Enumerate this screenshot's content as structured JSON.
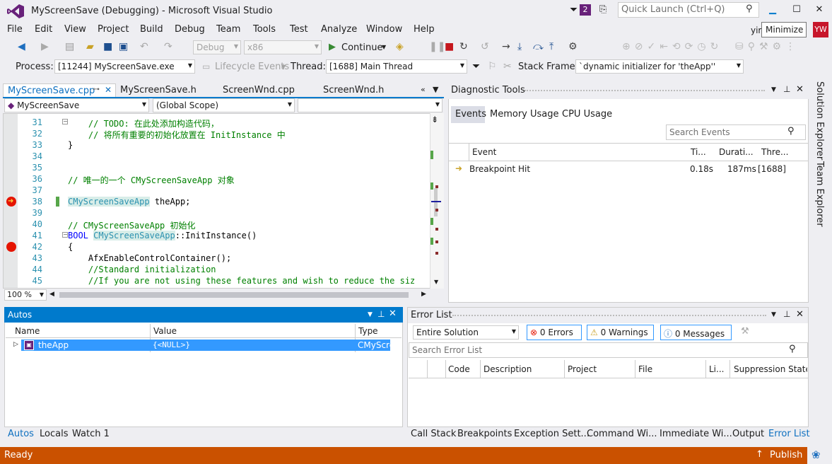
{
  "title": {
    "app_title": "MyScreenSave (Debugging) - Microsoft Visual Studio",
    "notif_count": "2",
    "quick_launch_placeholder": "Quick Launch (Ctrl+Q)",
    "user_name": "yir",
    "user_initials": "YW",
    "tooltip": "Minimize"
  },
  "menu": [
    "File",
    "Edit",
    "View",
    "Project",
    "Build",
    "Debug",
    "Team",
    "Tools",
    "Test",
    "Analyze",
    "Window",
    "Help"
  ],
  "toolbar": {
    "config": "Debug",
    "platform": "x86",
    "continue_label": "Continue"
  },
  "toolbar2": {
    "process_label": "Process:",
    "process_value": "[11244] MyScreenSave.exe",
    "lifecycle_label": "Lifecycle Events",
    "thread_label": "Thread:",
    "thread_value": "[1688] Main Thread",
    "stack_label": "Stack Frame:",
    "stack_value": "`dynamic initializer for 'theApp''"
  },
  "doc_tabs": [
    "MyScreenSave.cpp",
    "MyScreenSave.h",
    "ScreenWnd.cpp",
    "ScreenWnd.h"
  ],
  "editor": {
    "scope_left": "MyScreenSave",
    "scope_mid": "(Global Scope)",
    "scope_right": "",
    "zoom": "100 %",
    "lines": [
      {
        "n": "31",
        "text": "    // TODO: 在此处添加构造代码，"
      },
      {
        "n": "32",
        "text": "    // 将所有重要的初始化放置在 InitInstance 中"
      },
      {
        "n": "33",
        "text": "}"
      },
      {
        "n": "34",
        "text": ""
      },
      {
        "n": "35",
        "text": ""
      },
      {
        "n": "36",
        "text": "// 唯一的一个 CMyScreenSaveApp 对象"
      },
      {
        "n": "37",
        "text": ""
      },
      {
        "n": "38",
        "text": "CMyScreenSaveApp theApp;"
      },
      {
        "n": "39",
        "text": ""
      },
      {
        "n": "40",
        "text": "// CMyScreenSaveApp 初始化"
      },
      {
        "n": "41",
        "text": "BOOL CMyScreenSaveApp::InitInstance()"
      },
      {
        "n": "42",
        "text": "{"
      },
      {
        "n": "43",
        "text": "    AfxEnableControlContainer();"
      },
      {
        "n": "44",
        "text": "    //Standard initialization"
      },
      {
        "n": "45",
        "text": "    //If you are not using these features and wish to reduce the size"
      }
    ]
  },
  "diag": {
    "title": "Diagnostic Tools",
    "tabs": [
      "Events",
      "Memory Usage",
      "CPU Usage"
    ],
    "search_placeholder": "Search Events",
    "cols": [
      "Event",
      "Ti...",
      "Durati...",
      "Thre..."
    ],
    "row": {
      "event": "Breakpoint Hit",
      "time": "0.18s",
      "duration": "187ms",
      "thread": "[1688]"
    }
  },
  "autos": {
    "title": "Autos",
    "cols": [
      "Name",
      "Value",
      "Type"
    ],
    "row": {
      "name": "theApp",
      "value": "{<NULL>}",
      "type": "CMyScre"
    }
  },
  "errlist": {
    "title": "Error List",
    "scope": "Entire Solution",
    "errors": "0 Errors",
    "warnings": "0 Warnings",
    "messages": "0 Messages",
    "search_placeholder": "Search Error List",
    "cols": [
      "Code",
      "Description",
      "Project",
      "File",
      "Li...",
      "Suppression State"
    ]
  },
  "bottom_left_tabs": [
    "Autos",
    "Locals",
    "Watch 1"
  ],
  "bottom_right_tabs": [
    "Call Stack",
    "Breakpoints",
    "Exception Sett...",
    "Command Wi...",
    "Immediate Wi...",
    "Output",
    "Error List"
  ],
  "right_rail": [
    "Solution Explorer",
    "Team Explorer"
  ],
  "status": {
    "text": "Ready",
    "publish": "Publish"
  },
  "colors": {
    "accent": "#007acc",
    "status_bar": "#ca5100",
    "breakpoint": "#e51400",
    "vs_purple": "#68217a"
  }
}
